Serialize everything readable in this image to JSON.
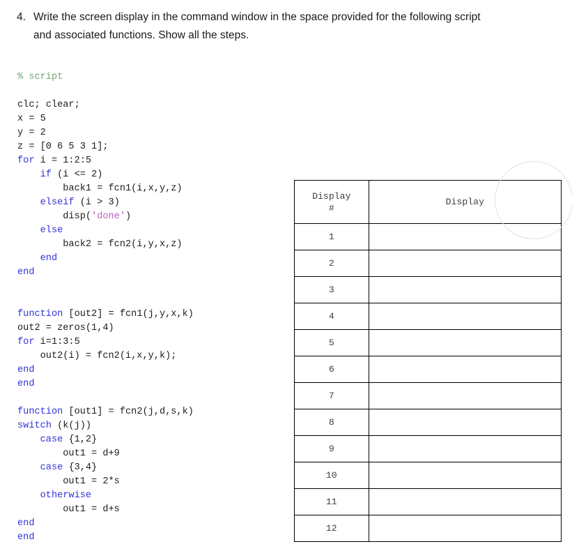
{
  "question": {
    "marker": "4.",
    "line1": "Write the screen display in the command window in the space provided for the following script",
    "line2": "and associated functions. Show all the steps."
  },
  "code": {
    "language": "matlab",
    "colors": {
      "keyword": "#3232d6",
      "comment": "#72a372",
      "string": "#bf5fbf",
      "plain": "#1c1c1c"
    },
    "lines": [
      [
        {
          "t": "comment",
          "s": "% script"
        }
      ],
      [],
      [
        {
          "t": "plain",
          "s": "clc; clear;"
        }
      ],
      [
        {
          "t": "plain",
          "s": "x = 5"
        }
      ],
      [
        {
          "t": "plain",
          "s": "y = 2"
        }
      ],
      [
        {
          "t": "plain",
          "s": "z = [0 6 5 3 1];"
        }
      ],
      [
        {
          "t": "keyword",
          "s": "for"
        },
        {
          "t": "plain",
          "s": " i = 1:2:5"
        }
      ],
      [
        {
          "t": "plain",
          "s": "    "
        },
        {
          "t": "keyword",
          "s": "if"
        },
        {
          "t": "plain",
          "s": " (i <= 2)"
        }
      ],
      [
        {
          "t": "plain",
          "s": "        back1 = fcn1(i,x,y,z)"
        }
      ],
      [
        {
          "t": "plain",
          "s": "    "
        },
        {
          "t": "keyword",
          "s": "elseif"
        },
        {
          "t": "plain",
          "s": " (i > 3)"
        }
      ],
      [
        {
          "t": "plain",
          "s": "        disp("
        },
        {
          "t": "string",
          "s": "'done'"
        },
        {
          "t": "plain",
          "s": ")"
        }
      ],
      [
        {
          "t": "plain",
          "s": "    "
        },
        {
          "t": "keyword",
          "s": "else"
        }
      ],
      [
        {
          "t": "plain",
          "s": "        back2 = fcn2(i,y,x,z)"
        }
      ],
      [
        {
          "t": "plain",
          "s": "    "
        },
        {
          "t": "keyword",
          "s": "end"
        }
      ],
      [
        {
          "t": "keyword",
          "s": "end"
        }
      ],
      [],
      [],
      [
        {
          "t": "keyword",
          "s": "function"
        },
        {
          "t": "plain",
          "s": " [out2] = fcn1(j,y,x,k)"
        }
      ],
      [
        {
          "t": "plain",
          "s": "out2 = zeros(1,4)"
        }
      ],
      [
        {
          "t": "keyword",
          "s": "for"
        },
        {
          "t": "plain",
          "s": " i=1:3:5"
        }
      ],
      [
        {
          "t": "plain",
          "s": "    out2(i) = fcn2(i,x,y,k);"
        }
      ],
      [
        {
          "t": "keyword",
          "s": "end"
        }
      ],
      [
        {
          "t": "keyword",
          "s": "end"
        }
      ],
      [],
      [
        {
          "t": "keyword",
          "s": "function"
        },
        {
          "t": "plain",
          "s": " [out1] = fcn2(j,d,s,k)"
        }
      ],
      [
        {
          "t": "keyword",
          "s": "switch"
        },
        {
          "t": "plain",
          "s": " (k(j))"
        }
      ],
      [
        {
          "t": "plain",
          "s": "    "
        },
        {
          "t": "keyword",
          "s": "case"
        },
        {
          "t": "plain",
          "s": " {1,2}"
        }
      ],
      [
        {
          "t": "plain",
          "s": "        out1 = d+9"
        }
      ],
      [
        {
          "t": "plain",
          "s": "    "
        },
        {
          "t": "keyword",
          "s": "case"
        },
        {
          "t": "plain",
          "s": " {3,4}"
        }
      ],
      [
        {
          "t": "plain",
          "s": "        out1 = 2*s"
        }
      ],
      [
        {
          "t": "plain",
          "s": "    "
        },
        {
          "t": "keyword",
          "s": "otherwise"
        }
      ],
      [
        {
          "t": "plain",
          "s": "        out1 = d+s"
        }
      ],
      [
        {
          "t": "keyword",
          "s": "end"
        }
      ],
      [
        {
          "t": "keyword",
          "s": "end"
        }
      ]
    ]
  },
  "table": {
    "headers": {
      "number_col_line1": "Display",
      "number_col_line2": "#",
      "display_col": "Display"
    },
    "rows": [
      {
        "number": "1",
        "display": ""
      },
      {
        "number": "2",
        "display": ""
      },
      {
        "number": "3",
        "display": ""
      },
      {
        "number": "4",
        "display": ""
      },
      {
        "number": "5",
        "display": ""
      },
      {
        "number": "6",
        "display": ""
      },
      {
        "number": "7",
        "display": ""
      },
      {
        "number": "8",
        "display": ""
      },
      {
        "number": "9",
        "display": ""
      },
      {
        "number": "10",
        "display": ""
      },
      {
        "number": "11",
        "display": ""
      },
      {
        "number": "12",
        "display": ""
      }
    ]
  },
  "decoration": {
    "circle_color": "#e2e2e2"
  }
}
